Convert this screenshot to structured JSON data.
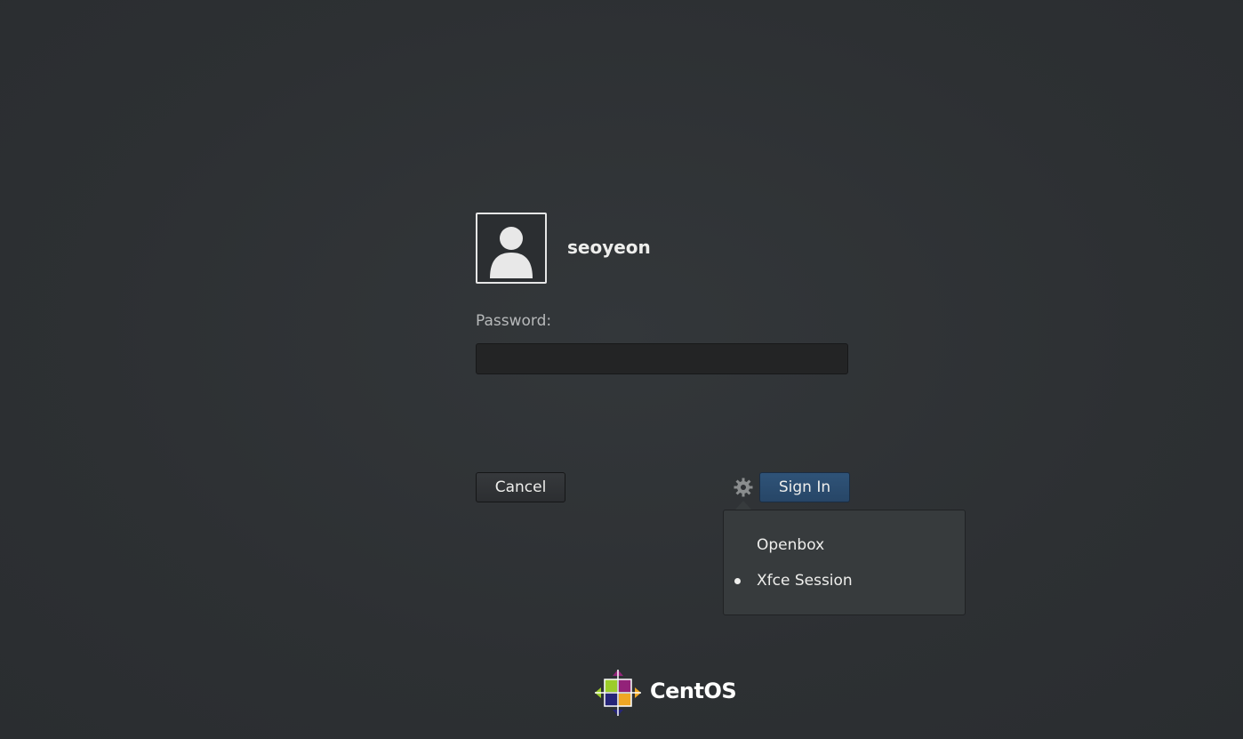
{
  "user": {
    "name": "seoyeon",
    "avatar_icon": "user-silhouette-icon"
  },
  "login": {
    "password_label": "Password:",
    "password_value": "",
    "cancel_label": "Cancel",
    "signin_label": "Sign In",
    "settings_icon": "gear-icon"
  },
  "session_menu": {
    "items": [
      {
        "label": "Openbox",
        "selected": false
      },
      {
        "label": "Xfce Session",
        "selected": true
      }
    ]
  },
  "branding": {
    "logo_text": "CentOS",
    "logo_icon": "centos-logo-icon"
  },
  "colors": {
    "background": "#2e3134",
    "signin_accent": "#2b4d71",
    "popup_bg": "#373b3d",
    "text": "#eeeeec"
  }
}
